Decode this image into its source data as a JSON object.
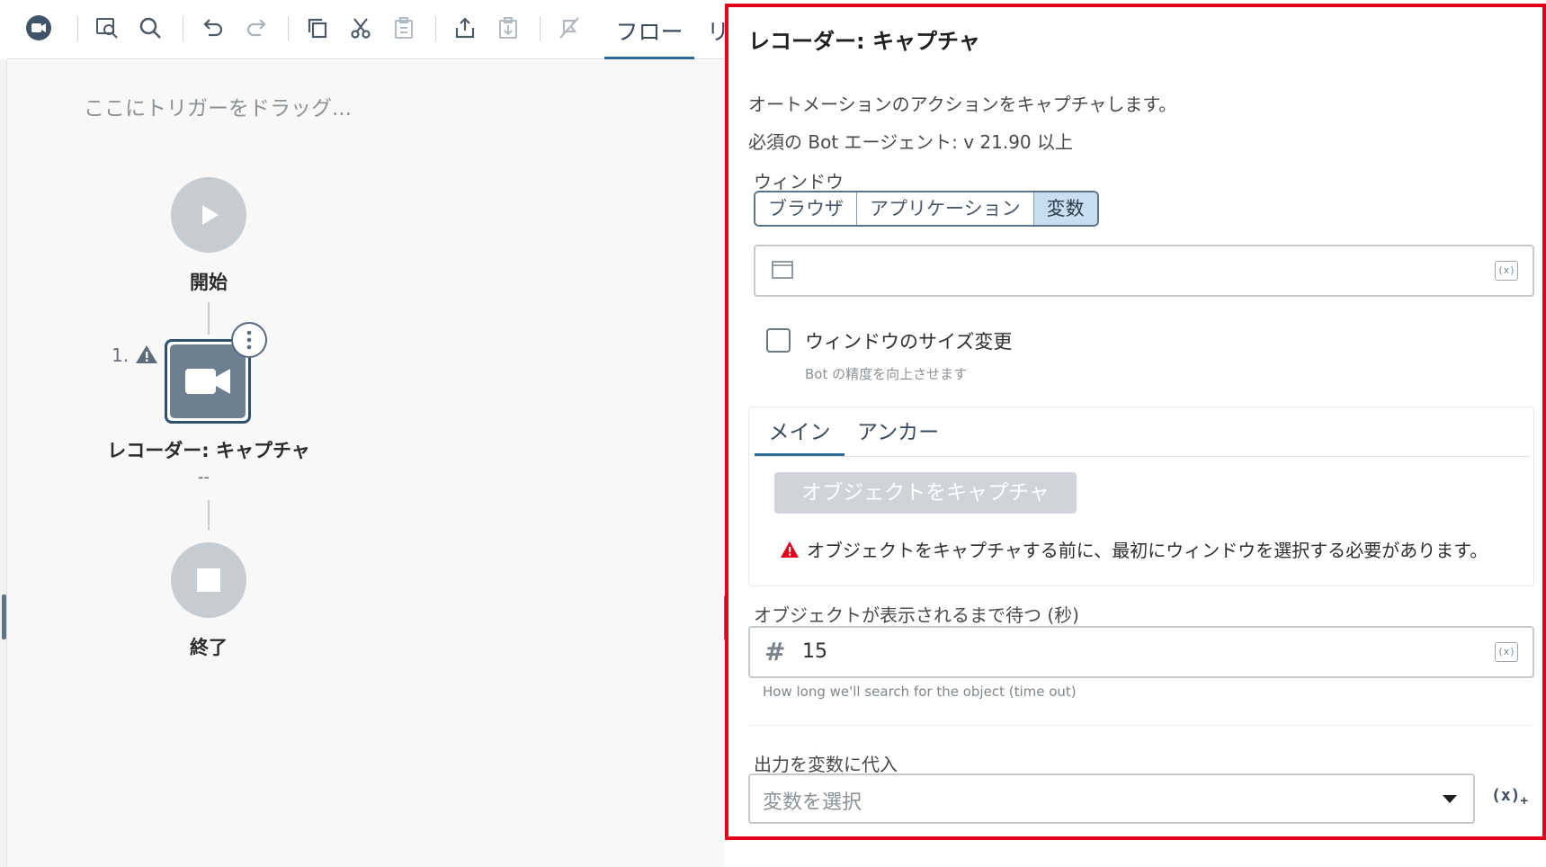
{
  "toolbar": {
    "icons": [
      "recorder-icon",
      "find-in-canvas-icon",
      "search-icon",
      "undo-icon",
      "redo-icon",
      "copy-icon",
      "cut-icon",
      "paste-icon",
      "export-icon",
      "import-icon",
      "disable-icon"
    ],
    "tab_flow": "フロー",
    "tab_next": "リ"
  },
  "canvas": {
    "trigger_hint": "ここにトリガーをドラッグ...",
    "start_label": "開始",
    "step_number": "1.",
    "action_label": "レコーダー: キャプチャ",
    "action_subtext": "--",
    "end_label": "終了"
  },
  "panel": {
    "title": "レコーダー: キャプチャ",
    "description": "オートメーションのアクションをキャプチャします。",
    "requirement": "必須の Bot エージェント: v 21.90 以上",
    "window_label": "ウィンドウ",
    "window_options": [
      {
        "label": "ブラウザ",
        "active": false
      },
      {
        "label": "アプリケーション",
        "active": false
      },
      {
        "label": "変数",
        "active": true
      }
    ],
    "window_field_varbtn": "(x)",
    "resize_label": "ウィンドウのサイズ変更",
    "resize_help": "Bot の精度を向上させます",
    "resize_checked": false,
    "tabs": {
      "main": "メイン",
      "anchor": "アンカー"
    },
    "capture_button": "オブジェクトをキャプチャ",
    "capture_warning": "オブジェクトをキャプチャする前に、最初にウィンドウを選択する必要があります。",
    "wait_label": "オブジェクトが表示されるまで待つ (秒)",
    "wait_hash": "#",
    "wait_value": "15",
    "wait_varbtn": "(x)",
    "wait_help": "How long we'll search for the object (time out)",
    "output_label": "出力を変数に代入",
    "output_placeholder": "変数を選択",
    "output_varbtn": "(x)",
    "output_varbtn_sub": "+"
  },
  "colors": {
    "panel_border": "#e3001b",
    "accent": "#2d6b9a",
    "node_dark": "#6e7f90",
    "warning": "#e3001b"
  }
}
